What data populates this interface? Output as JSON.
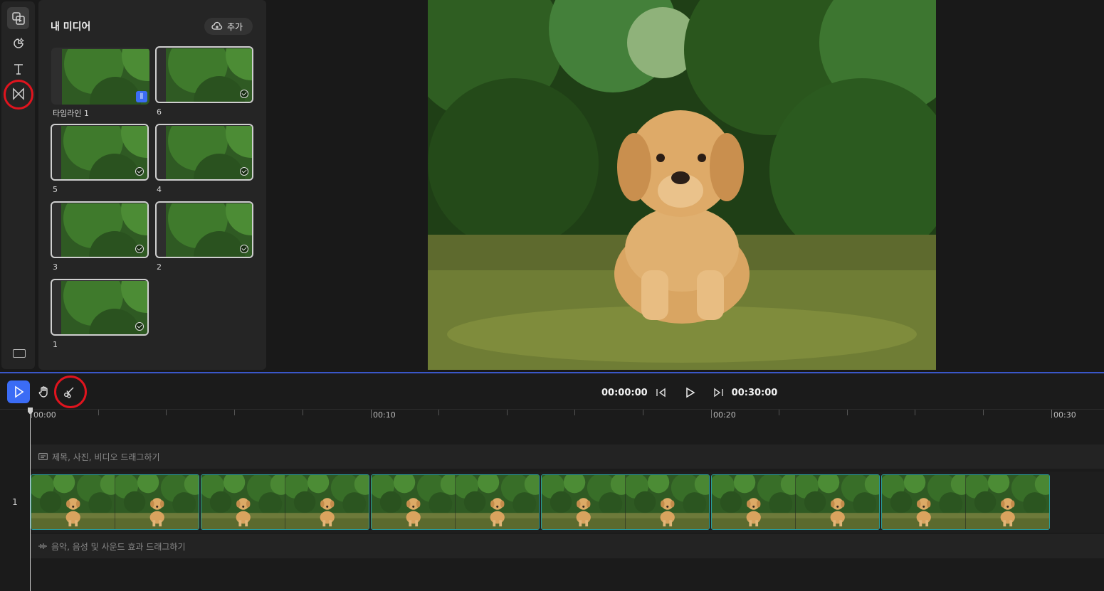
{
  "media_panel": {
    "title": "내 미디어",
    "add_label": "추가",
    "items": [
      {
        "label": "타임라인 1",
        "badge_icon": "sequence-icon",
        "selected": false
      },
      {
        "label": "6",
        "selected": true
      },
      {
        "label": "5",
        "selected": true
      },
      {
        "label": "4",
        "selected": true
      },
      {
        "label": "3",
        "selected": true
      },
      {
        "label": "2",
        "selected": true
      },
      {
        "label": "1",
        "selected": true
      }
    ]
  },
  "rail": {
    "icons": [
      "media-icon",
      "effects-icon",
      "text-icon",
      "transitions-icon",
      "keyboard-icon"
    ]
  },
  "timeline": {
    "tools": [
      "select-tool-icon",
      "hand-tool-icon",
      "split-tool-icon"
    ],
    "current_time": "00:00:00",
    "total_time": "00:30:00",
    "ruler_labels": [
      "00:00",
      "00:10",
      "00:20",
      "00:30"
    ],
    "text_track_hint": "제목, 사진, 비디오 드래그하기",
    "video_track_number": "1",
    "audio_track_hint": "음악, 음성 및 사운드 효과 드래그하기",
    "clip_count": 6
  },
  "colors": {
    "accent": "#3b6cf5",
    "highlight_ring": "#e0141e",
    "clip_border": "#2a9c9c"
  }
}
